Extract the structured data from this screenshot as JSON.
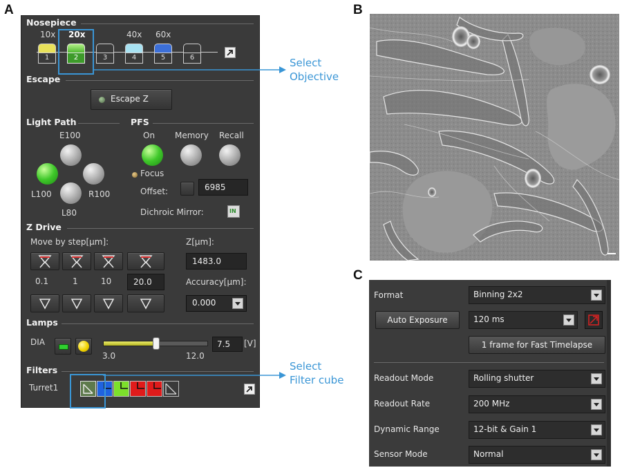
{
  "panel_labels": {
    "a": "A",
    "b": "B",
    "c": "C"
  },
  "nosepiece": {
    "title": "Nosepiece",
    "magnifications": [
      "10x",
      "20x",
      "",
      "40x",
      "60x",
      ""
    ],
    "selected_index": 1,
    "positions": [
      "1",
      "2",
      "3",
      "4",
      "5",
      "6"
    ],
    "colors": [
      "#e8e15a",
      "#7ed957",
      "",
      "#a8e2f2",
      "#3c6fd8",
      ""
    ]
  },
  "escape": {
    "title": "Escape",
    "button_label": "Escape Z"
  },
  "light_path": {
    "title": "Light Path",
    "top": "E100",
    "left": "L100",
    "right": "R100",
    "bottom": "L80",
    "active": "L100"
  },
  "pfs": {
    "title": "PFS",
    "on_label": "On",
    "memory_label": "Memory",
    "recall_label": "Recall",
    "focus_label": "Focus",
    "offset_label": "Offset:",
    "offset_value": "6985",
    "dichroic_label": "Dichroic Mirror:",
    "dichroic_state": "IN"
  },
  "z_drive": {
    "title": "Z Drive",
    "move_label": "Move by step[μm]:",
    "steps": [
      "0.1",
      "1",
      "10"
    ],
    "custom_step": "20.0",
    "z_label": "Z[μm]:",
    "z_value": "1483.0",
    "accuracy_label": "Accuracy[μm]:",
    "accuracy_value": "0.000"
  },
  "lamps": {
    "title": "Lamps",
    "source": "DIA",
    "slider_min": "3.0",
    "slider_max": "12.0",
    "value": "7.5",
    "unit": "[V]",
    "level_fraction": 0.5
  },
  "filters": {
    "title": "Filters",
    "turret": "Turret1",
    "cube_colors": [
      "#6f8f5a",
      "#1f63e0",
      "#7ce02b",
      "#e01b1b",
      "#e01b1b",
      ""
    ],
    "selected_index": 0
  },
  "callouts": {
    "objective": [
      "Select",
      "Objective"
    ],
    "filter": [
      "Select",
      "Filter cube"
    ]
  },
  "camera": {
    "format_label": "Format",
    "format_value": "Binning 2x2",
    "auto_exposure_label": "Auto Exposure",
    "exposure_value": "120 ms",
    "fast_timelapse_label": "1 frame for Fast Timelapse",
    "readout_mode_label": "Readout Mode",
    "readout_mode_value": "Rolling shutter",
    "readout_rate_label": "Readout Rate",
    "readout_rate_value": "200 MHz",
    "dynamic_range_label": "Dynamic Range",
    "dynamic_range_value": "12-bit & Gain 1",
    "sensor_mode_label": "Sensor Mode",
    "sensor_mode_value": "Normal"
  },
  "colors": {
    "callout": "#3a96d6",
    "panel_bg": "#3a3a3a",
    "active_green": "#3fc82a"
  }
}
